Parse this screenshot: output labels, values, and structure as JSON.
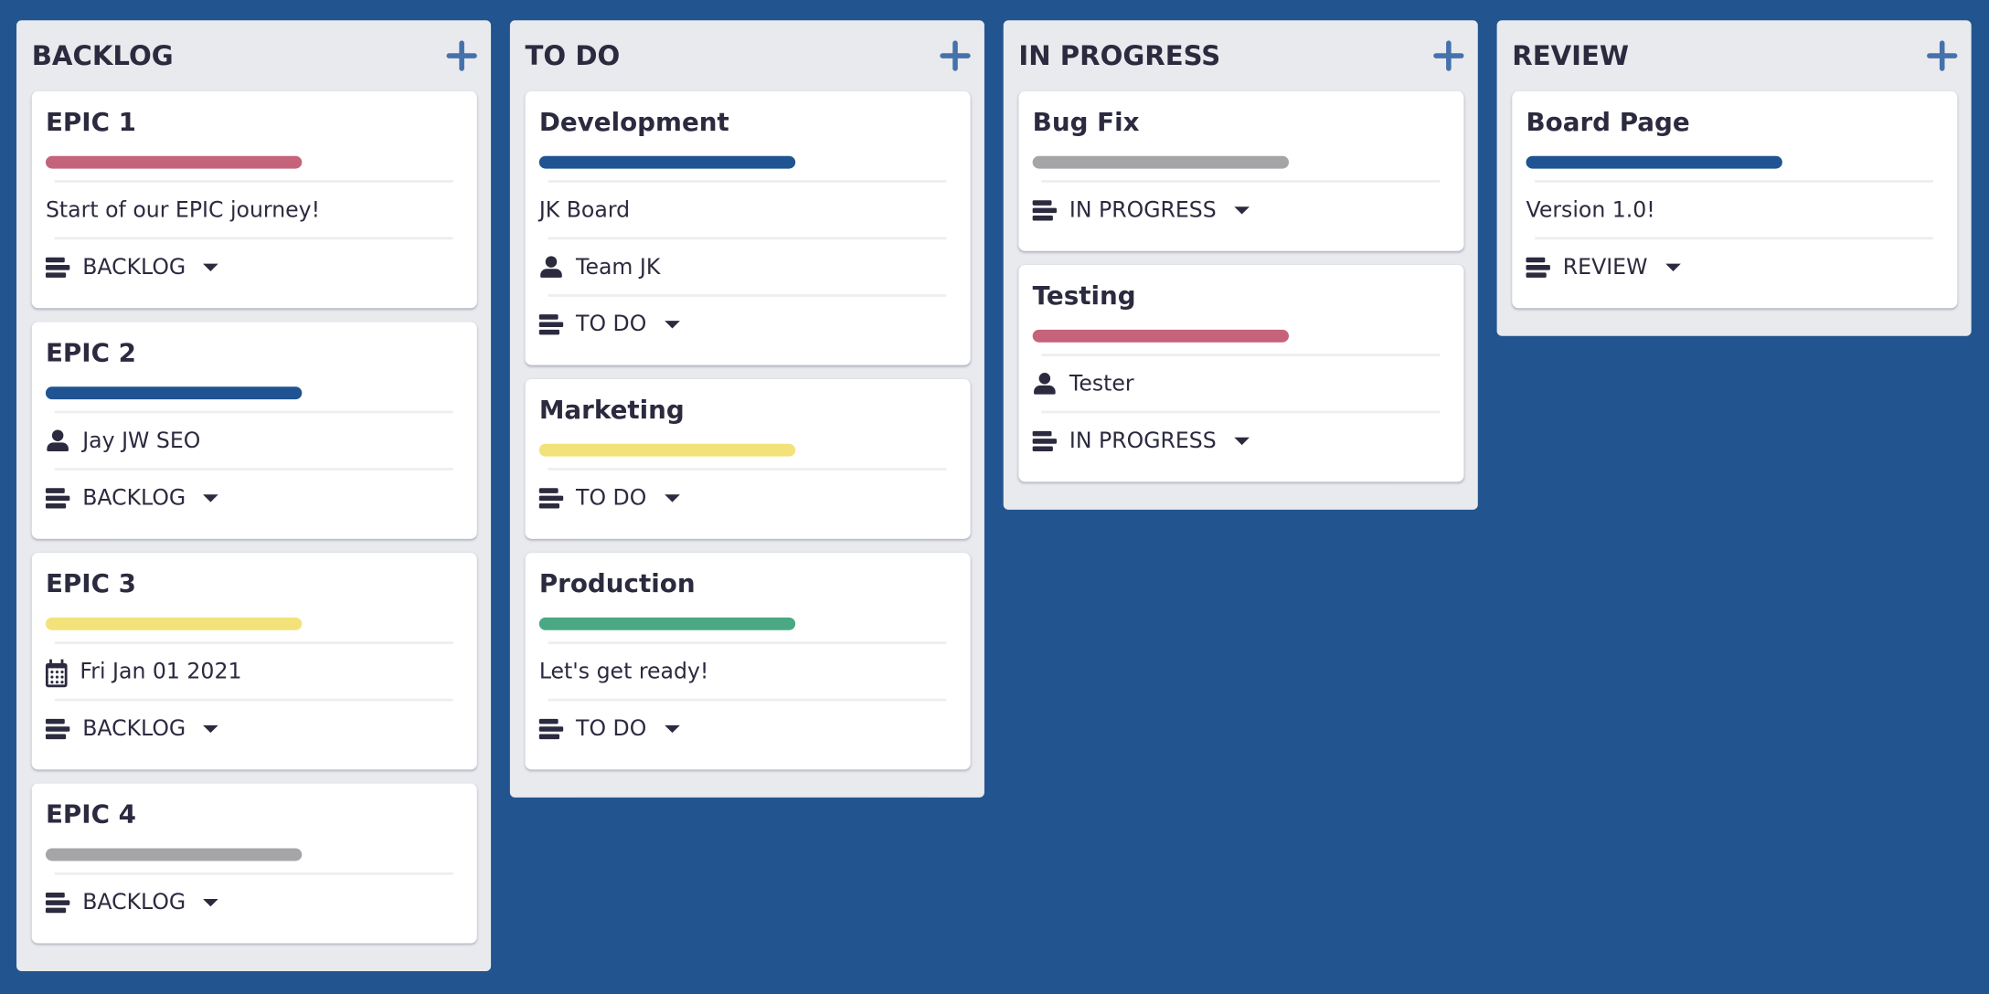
{
  "columns": [
    {
      "title": "BACKLOG",
      "cards": [
        {
          "title": "EPIC 1",
          "color": "#c5637a",
          "description": "Start of our EPIC journey!",
          "status": "BACKLOG"
        },
        {
          "title": "EPIC 2",
          "color": "#1f5391",
          "assignee": "Jay JW SEO",
          "status": "BACKLOG"
        },
        {
          "title": "EPIC 3",
          "color": "#f3e27a",
          "date": "Fri Jan 01 2021",
          "status": "BACKLOG"
        },
        {
          "title": "EPIC 4",
          "color": "#a5a5a7",
          "status": "BACKLOG"
        }
      ]
    },
    {
      "title": "TO DO",
      "cards": [
        {
          "title": "Development",
          "color": "#1f5391",
          "description": "JK Board",
          "assignee": "Team JK",
          "status": "TO DO"
        },
        {
          "title": "Marketing",
          "color": "#f3e27a",
          "status": "TO DO"
        },
        {
          "title": "Production",
          "color": "#4aa883",
          "description": "Let's get ready!",
          "status": "TO DO"
        }
      ]
    },
    {
      "title": "IN PROGRESS",
      "cards": [
        {
          "title": "Bug Fix",
          "color": "#a5a5a7",
          "status": "IN PROGRESS"
        },
        {
          "title": "Testing",
          "color": "#c5637a",
          "assignee": "Tester",
          "status": "IN PROGRESS"
        }
      ]
    },
    {
      "title": "REVIEW",
      "cards": [
        {
          "title": "Board Page",
          "color": "#1f5391",
          "description": "Version 1.0!",
          "status": "REVIEW"
        }
      ]
    }
  ]
}
